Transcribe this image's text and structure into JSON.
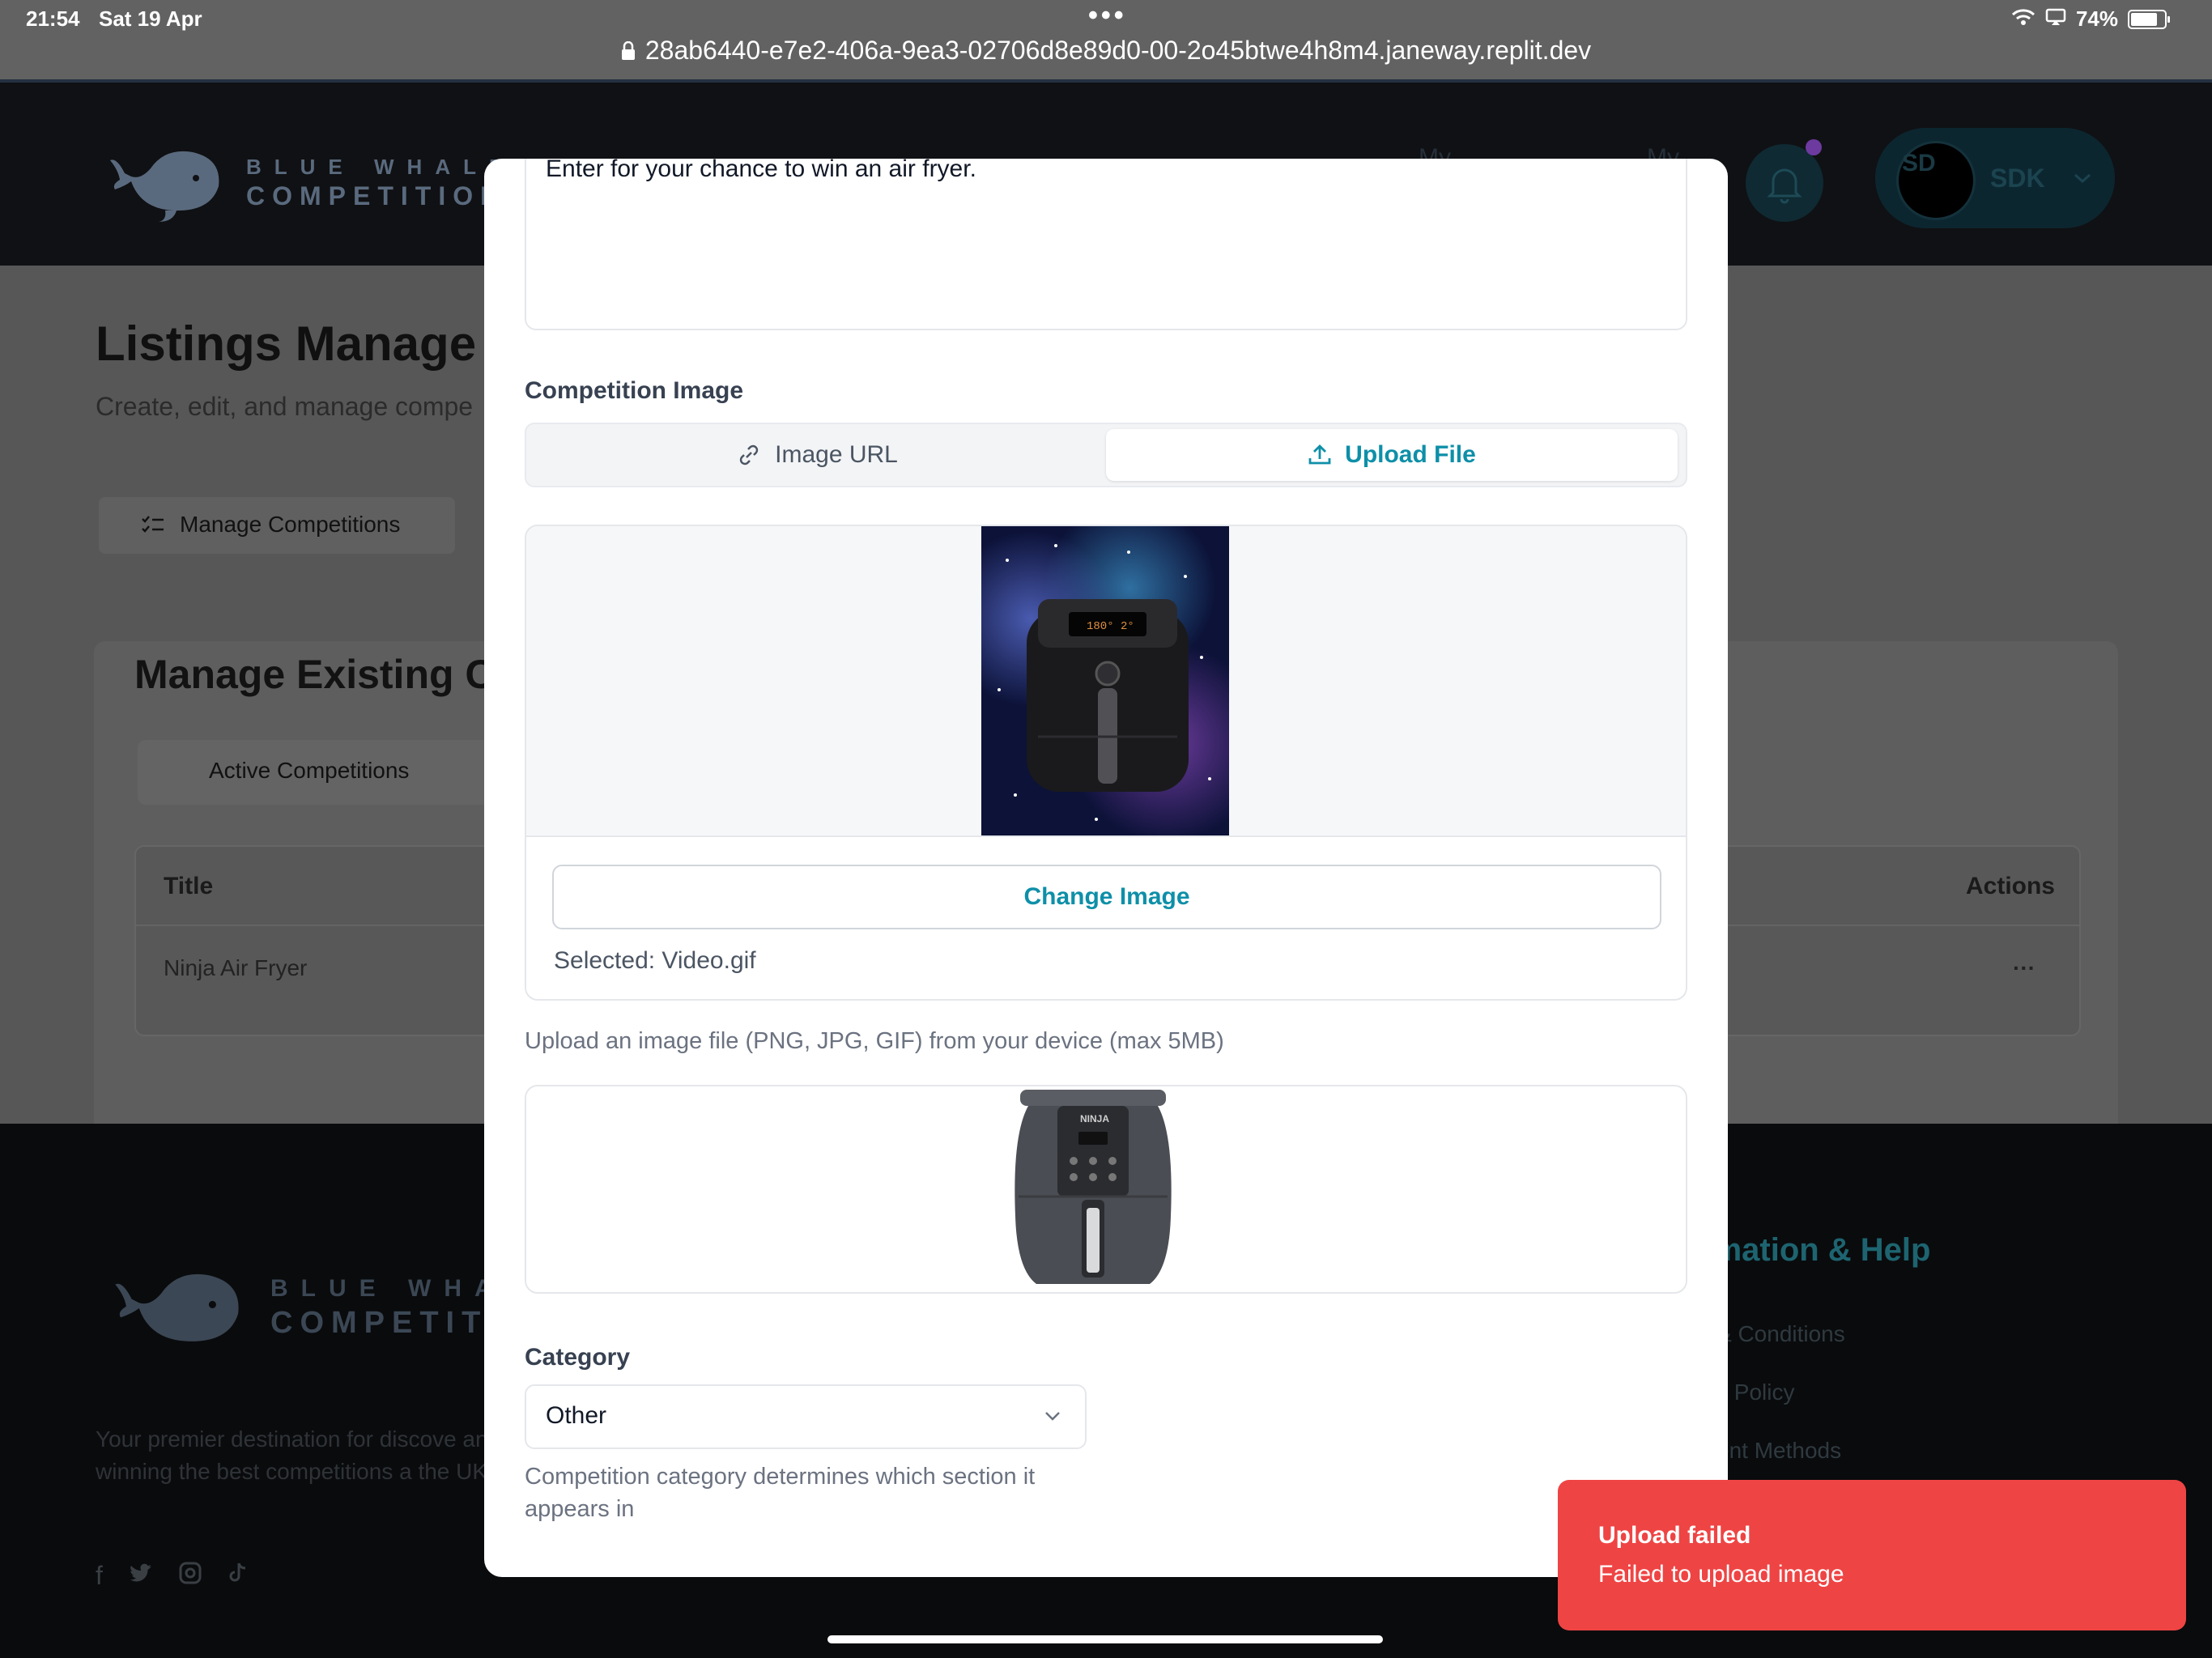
{
  "status_bar": {
    "time": "21:54",
    "date": "Sat 19 Apr",
    "url": "28ab6440-e7e2-406a-9ea3-02706d8e89d0-00-2o45btwe4h8m4.janeway.replit.dev",
    "battery": "74%",
    "more_dots": "•••"
  },
  "header": {
    "logo_line1": "BLUE WHALE",
    "logo_line2": "COMPETITIONS",
    "user_initials": "SD",
    "user_name": "SDK",
    "nav_faint_1": "My",
    "nav_faint_2": "My"
  },
  "page": {
    "title": "Listings Manage",
    "subtitle": "Create, edit, and manage compe",
    "tab_manage": "Manage Competitions",
    "card_title": "Manage Existing C",
    "subtab_active": "Active Competitions",
    "table": {
      "col_title": "Title",
      "col_actions": "Actions",
      "row_title": "Ninja Air Fryer",
      "row_menu": "···"
    }
  },
  "footer": {
    "logo_line1": "BLUE WHAL",
    "logo_line2": "COMPETITIO",
    "tagline": "Your premier destination for discove and winning the best competitions a the UK.",
    "info_title": "rmation & Help",
    "links": [
      "& Conditions",
      "y Policy",
      "ent Methods"
    ]
  },
  "modal": {
    "description_text": "Enter for your chance to win an air fryer.",
    "image_label": "Competition Image",
    "tab_url": "Image URL",
    "tab_upload": "Upload File",
    "change_image": "Change Image",
    "selected_file": "Selected: Video.gif",
    "upload_help": "Upload an image file (PNG, JPG, GIF) from your device (max 5MB)",
    "category_label": "Category",
    "category_value": "Other",
    "category_help": "Competition category determines which section it appears in"
  },
  "toast": {
    "title": "Upload failed",
    "message": "Failed to upload image",
    "color": "#ef4444"
  },
  "colors": {
    "accent": "#0e8fa8",
    "error": "#ef4444"
  }
}
